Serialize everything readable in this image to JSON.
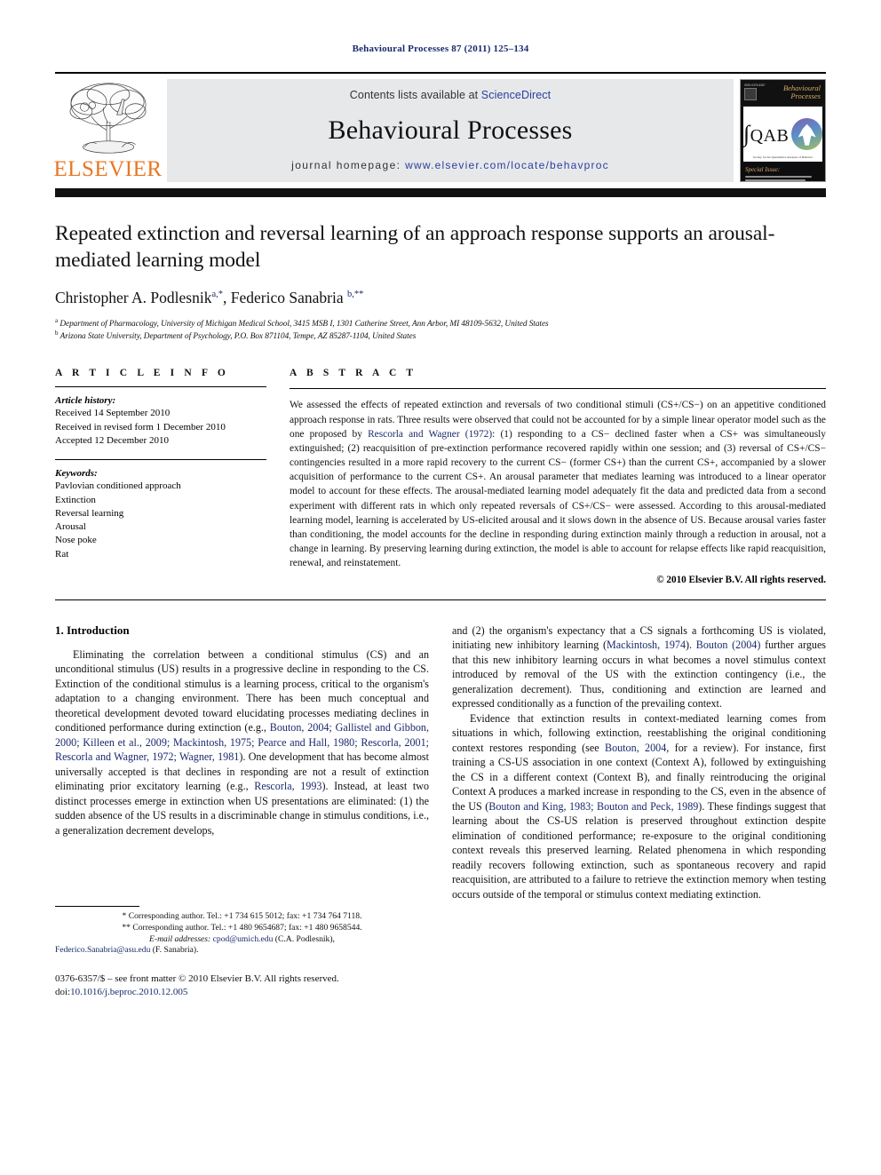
{
  "running_head": "Behavioural Processes 87 (2011) 125–134",
  "masthead": {
    "publisher_logo_name": "ELSEVIER",
    "contents_prefix": "Contents lists available at ",
    "contents_link": "ScienceDirect",
    "journal_name": "Behavioural Processes",
    "homepage_prefix": "journal homepage: ",
    "homepage_url": "www.elsevier.com/locate/behavproc",
    "cover": {
      "issn_line": "ISSN 0376-6357",
      "title_line1": "Behavioural",
      "title_line2": "Processes",
      "emblem_text": "QAB",
      "emblem_caption": "Society for the Quantitative Analyses of Behavior",
      "special_issue_label": "Special Issue:",
      "special_issue_desc": "Quantitative Analyses of Behavior"
    }
  },
  "article": {
    "title": "Repeated extinction and reversal learning of an approach response supports an arousal-mediated learning model",
    "authors_plain": "Christopher A. Podlesnik",
    "author1": "Christopher A. Podlesnik",
    "author1_sup": "a,*",
    "author2": "Federico Sanabria",
    "author2_sup": "b,**",
    "affiliation_a_sup": "a",
    "affiliation_a": "Department of Pharmacology, University of Michigan Medical School, 3415 MSB I, 1301 Catherine Street, Ann Arbor, MI 48109-5632, United States",
    "affiliation_b_sup": "b",
    "affiliation_b": "Arizona State University, Department of Psychology, P.O. Box 871104, Tempe, AZ 85287-1104, United States"
  },
  "article_info": {
    "label": "A R T I C L E    I N F O",
    "history_label": "Article history:",
    "history": [
      "Received 14 September 2010",
      "Received in revised form 1 December 2010",
      "Accepted 12 December 2010"
    ],
    "keywords_label": "Keywords:",
    "keywords": [
      "Pavlovian conditioned approach",
      "Extinction",
      "Reversal learning",
      "Arousal",
      "Nose poke",
      "Rat"
    ]
  },
  "abstract": {
    "label": "A B S T R A C T",
    "part1": "We assessed the effects of repeated extinction and reversals of two conditional stimuli (CS+/CS−) on an appetitive conditioned approach response in rats. Three results were observed that could not be accounted for by a simple linear operator model such as the one proposed by ",
    "ref1": "Rescorla and Wagner (1972)",
    "part2": ": (1) responding to a CS− declined faster when a CS+ was simultaneously extinguished; (2) reacquisition of pre-extinction performance recovered rapidly within one session; and (3) reversal of CS+/CS− contingencies resulted in a more rapid recovery to the current CS− (former CS+) than the current CS+, accompanied by a slower acquisition of performance to the current CS+. An arousal parameter that mediates learning was introduced to a linear operator model to account for these effects. The arousal-mediated learning model adequately fit the data and predicted data from a second experiment with different rats in which only repeated reversals of CS+/CS− were assessed. According to this arousal-mediated learning model, learning is accelerated by US-elicited arousal and it slows down in the absence of US. Because arousal varies faster than conditioning, the model accounts for the decline in responding during extinction mainly through a reduction in arousal, not a change in learning. By preserving learning during extinction, the model is able to account for relapse effects like rapid reacquisition, renewal, and reinstatement.",
    "copyright": "© 2010 Elsevier B.V. All rights reserved."
  },
  "introduction": {
    "heading": "1.  Introduction",
    "p1_a": "Eliminating the correlation between a conditional stimulus (CS) and an unconditional stimulus (US) results in a progressive decline in responding to the CS. Extinction of the conditional stimulus is a learning process, critical to the organism's adaptation to a changing environment. There has been much conceptual and theoretical development devoted toward elucidating processes mediating declines in conditioned performance during extinction (e.g., ",
    "p1_refs1": "Bouton, 2004; Gallistel and Gibbon, 2000; Killeen et al., 2009; Mackintosh, 1975; Pearce and Hall, 1980; Rescorla, 2001; Rescorla and Wagner, 1972; Wagner, 1981",
    "p1_b": "). One development that has become almost universally accepted is that declines in responding are not a result of extinction eliminating prior excitatory learning (e.g., ",
    "p1_refs2": "Rescorla, 1993",
    "p1_c": "). Instead, at least two distinct processes emerge in extinction when US presentations are eliminated: (1) the sudden absence of the US results in a discriminable change in stimulus conditions, i.e., a generalization decrement develops,",
    "p2_a": "and (2) the organism's expectancy that a CS signals a forthcoming US is violated, initiating new inhibitory learning (",
    "p2_refs1": "Mackintosh, 1974",
    "p2_b": "). ",
    "p2_refs2": "Bouton (2004)",
    "p2_c": " further argues that this new inhibitory learning occurs in what becomes a novel stimulus context introduced by removal of the US with the extinction contingency (i.e., the generalization decrement). Thus, conditioning and extinction are learned and expressed conditionally as a function of the prevailing context.",
    "p3_a": "Evidence that extinction results in context-mediated learning comes from situations in which, following extinction, reestablishing the original conditioning context restores responding (see ",
    "p3_refs1": "Bouton, 2004",
    "p3_b": ", for a review). For instance, first training a CS-US association in one context (Context A), followed by extinguishing the CS in a different context (Context B), and finally reintroducing the original Context A produces a marked increase in responding to the CS, even in the absence of the US (",
    "p3_refs2": "Bouton and King, 1983; Bouton and Peck, 1989",
    "p3_c": "). These findings suggest that learning about the CS-US relation is preserved throughout extinction despite elimination of conditioned performance; re-exposure to the original conditioning context reveals this preserved learning. Related phenomena in which responding readily recovers following extinction, such as spontaneous recovery and rapid reacquisition, are attributed to a failure to retrieve the extinction memory when testing occurs outside of the temporal or stimulus context mediating extinction."
  },
  "footnotes": {
    "corresponding1": "* Corresponding author. Tel.: +1 734 615 5012; fax: +1 734 764 7118.",
    "corresponding2": "** Corresponding author. Tel.: +1 480 9654687; fax: +1 480 9658544.",
    "email_label": "E-mail addresses:",
    "email1": "cpod@umich.edu",
    "email1_owner": " (C.A. Podlesnik),",
    "email2": "Federico.Sanabria@asu.edu",
    "email2_owner": " (F. Sanabria)."
  },
  "frontmatter": {
    "line1": "0376-6357/$ – see front matter © 2010 Elsevier B.V. All rights reserved.",
    "doi_prefix": "doi:",
    "doi": "10.1016/j.beproc.2010.12.005"
  },
  "colors": {
    "link": "#1a2a6c",
    "elsevier_orange": "#E87722",
    "band_gray": "#e7e8ea"
  }
}
